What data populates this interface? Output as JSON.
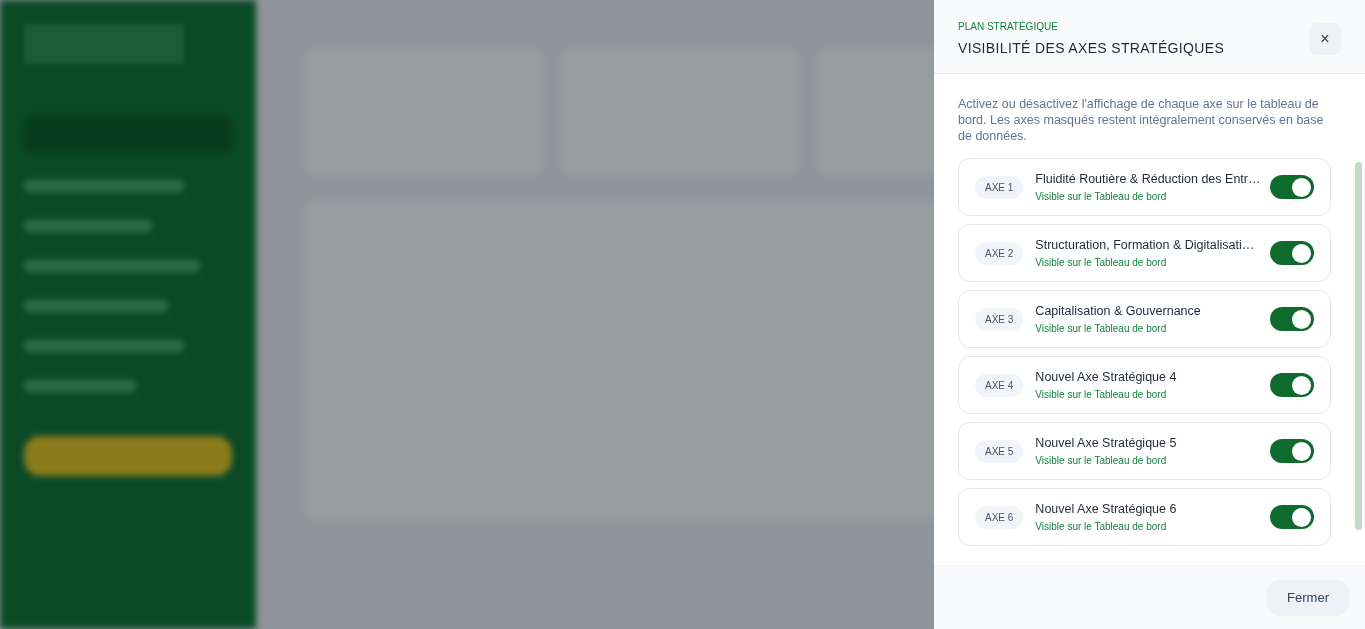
{
  "panel": {
    "eyebrow": "PLAN STRATÉGIQUE",
    "title": "VISIBILITÉ DES AXES STRATÉGIQUES",
    "close": "×",
    "description": "Activez ou désactivez l'affichage de chaque axe sur le tableau de bord. Les axes masqués restent intégralement conservés en base de données."
  },
  "axes": [
    {
      "badge": "AXE 1",
      "name": "Fluidité Routière & Réduction des Entr…",
      "status": "Visible sur le Tableau de bord",
      "on": true
    },
    {
      "badge": "AXE 2",
      "name": "Structuration, Formation & Digitalisati…",
      "status": "Visible sur le Tableau de bord",
      "on": true
    },
    {
      "badge": "AXE 3",
      "name": "Capitalisation & Gouvernance",
      "status": "Visible sur le Tableau de bord",
      "on": true
    },
    {
      "badge": "AXE 4",
      "name": "Nouvel Axe Stratégique 4",
      "status": "Visible sur le Tableau de bord",
      "on": true
    },
    {
      "badge": "AXE 5",
      "name": "Nouvel Axe Stratégique 5",
      "status": "Visible sur le Tableau de bord",
      "on": true
    },
    {
      "badge": "AXE 6",
      "name": "Nouvel Axe Stratégique 6",
      "status": "Visible sur le Tableau de bord",
      "on": true
    }
  ],
  "footer": {
    "close_button": "Fermer"
  }
}
